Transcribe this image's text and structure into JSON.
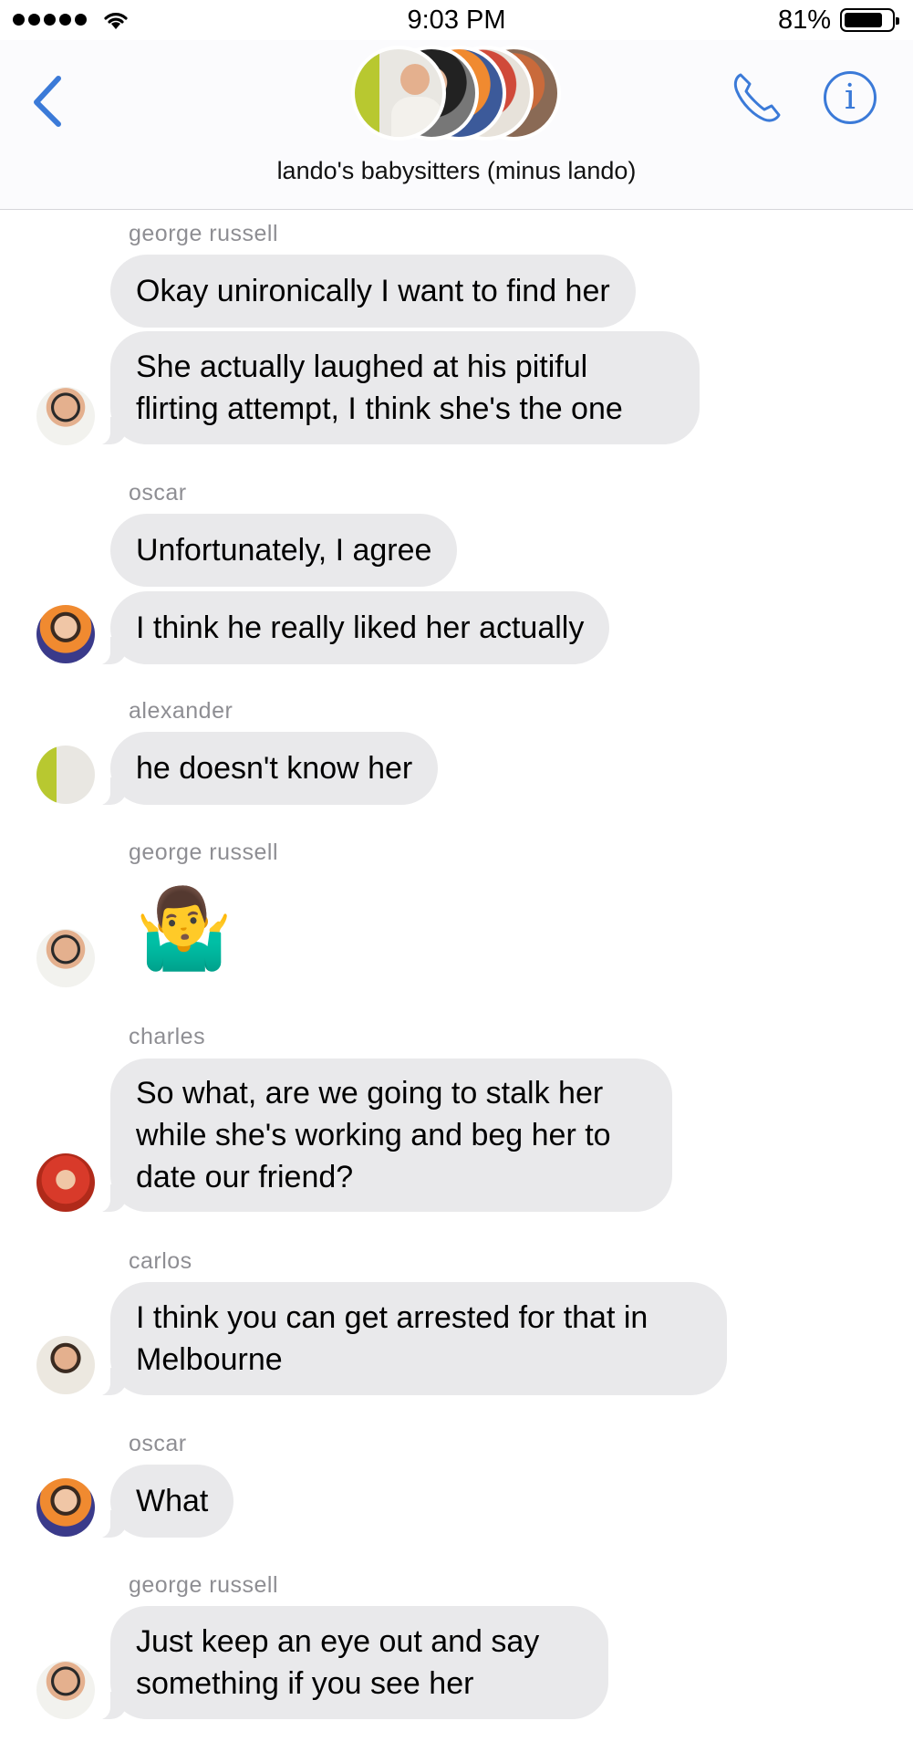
{
  "status_bar": {
    "time": "9:03 PM",
    "battery_percent": "81%",
    "battery_level": 0.81,
    "signal_bars": 5
  },
  "header": {
    "group_name": "lando's babysitters (minus lando)",
    "back_icon": "chevron-left-icon",
    "call_icon": "phone-icon",
    "info_icon": "info-icon",
    "info_glyph": "i",
    "accent_color": "#3b7ad8"
  },
  "messages": [
    {
      "sender": "george russell",
      "bubbles": [
        "Okay unironically I want to find her",
        "She actually laughed at his pitiful flirting attempt, I think she's the one"
      ]
    },
    {
      "sender": "oscar",
      "bubbles": [
        "Unfortunately, I agree",
        "I think he really liked her actually"
      ]
    },
    {
      "sender": "alexander",
      "bubbles": [
        "he doesn't know her"
      ]
    },
    {
      "sender": "george russell",
      "bubbles": [
        "🤷‍♂️"
      ]
    },
    {
      "sender": "charles",
      "bubbles": [
        "So what, are we going to stalk her while she's working and beg her to date our friend?"
      ]
    },
    {
      "sender": "carlos",
      "bubbles": [
        "I think you can get arrested for that in Melbourne"
      ]
    },
    {
      "sender": "oscar",
      "bubbles": [
        "What"
      ]
    },
    {
      "sender": "george russell",
      "bubbles": [
        "Just keep an eye out and say something if you see her"
      ]
    }
  ],
  "colors": {
    "bubble_bg": "#e9e9eb",
    "sender_name": "#8e8e93"
  }
}
